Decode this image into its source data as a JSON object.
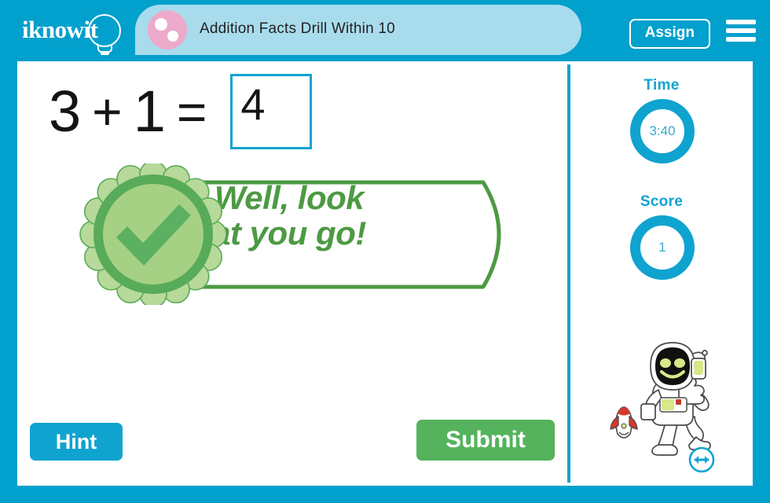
{
  "brand": {
    "logo_text": "iknowit",
    "logo_icon": "lightbulb-icon",
    "primary_color": "#02a0cc",
    "accent_green": "#54b35c",
    "title_pill_color": "#a8dced",
    "pink_color": "#edaacb"
  },
  "header": {
    "lesson_title": "Addition Facts Drill Within 10",
    "assign_label": "Assign",
    "menu_icon": "hamburger-menu-icon"
  },
  "question": {
    "operand_left": "3",
    "operator": "+",
    "operand_right": "1",
    "equals": "=",
    "answer_value": "4"
  },
  "feedback": {
    "message_line1": "Well, look",
    "message_line2": "at you go!",
    "icon": "check-badge-icon",
    "state_color": "#4d9a43",
    "rosette_petal_color": "#b7d99a",
    "rosette_ring_color": "#58ab58",
    "rosette_inner_color": "#a6d184",
    "check_color": "#5cb062"
  },
  "actions": {
    "hint_label": "Hint",
    "submit_label": "Submit"
  },
  "stats": {
    "time_label": "Time",
    "time_value": "3:40",
    "score_label": "Score",
    "score_value": "1",
    "ring_color": "#0fa3d0"
  },
  "mascot": {
    "character": "astronaut-mascot",
    "companion": "rocket-icon",
    "resize_icon": "resize-horizontal-icon"
  }
}
